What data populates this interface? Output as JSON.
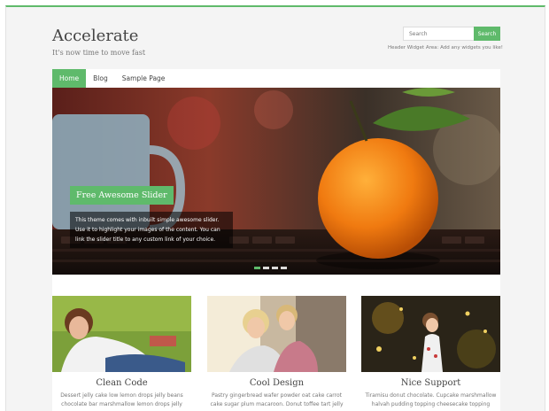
{
  "site": {
    "title": "Accelerate",
    "tagline": "It's now time to move fast"
  },
  "header": {
    "search_placeholder": "Search",
    "search_button": "Search",
    "widget_text": "Header Widget Area: Add any widgets you like!"
  },
  "nav": {
    "items": [
      {
        "label": "Home",
        "active": true
      },
      {
        "label": "Blog",
        "active": false
      },
      {
        "label": "Sample Page",
        "active": false
      }
    ]
  },
  "slider": {
    "title": "Free Awesome Slider",
    "description": "This theme comes with inbuilt simple awesome slider. Use it to highlight your images of the content. You can link the slider title to any custom link of your choice.",
    "slide_count": 4,
    "active_slide": 1
  },
  "features": [
    {
      "title": "Clean Code",
      "text": "Dessert jelly cake low lemon drops jelly beans chocolate bar marshmallow lemon drops jelly"
    },
    {
      "title": "Cool Design",
      "text": "Pastry gingerbread wafer powder oat cake carrot cake sugar plum macaroon. Donut toffee tart jelly"
    },
    {
      "title": "Nice Support",
      "text": "Tiramisu donut chocolate. Cupcake marshmallow halvah pudding topping cheesecake topping"
    }
  ],
  "colors": {
    "accent": "#5fba6b"
  }
}
